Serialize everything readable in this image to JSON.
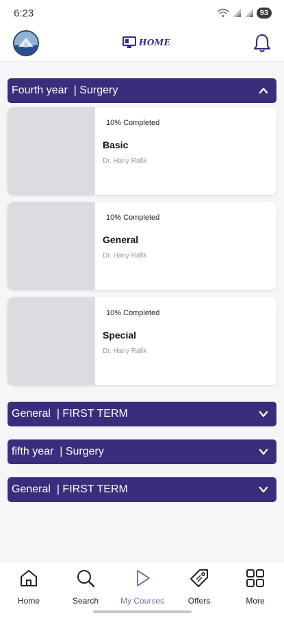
{
  "status_bar": {
    "time": "6:23",
    "battery": "93"
  },
  "header": {
    "logo_text": "HOME",
    "logo_icon": "monitor-logo-icon",
    "notification_icon": "bell-icon"
  },
  "accordions": [
    {
      "title": "Fourth year  | Surgery",
      "expanded": true,
      "courses": [
        {
          "progress": "10% Completed",
          "title": "Basic",
          "instructor": "Dr. Hany Rafik"
        },
        {
          "progress": "10% Completed",
          "title": "General",
          "instructor": "Dr. Hany Rafik"
        },
        {
          "progress": "10% Completed",
          "title": "Special",
          "instructor": "Dr. Hany Rafik"
        }
      ]
    },
    {
      "title": "General  | FIRST TERM",
      "expanded": false
    },
    {
      "title": "fifth year  | Surgery",
      "expanded": false
    },
    {
      "title": "General  | FIRST TERM",
      "expanded": false
    }
  ],
  "bottom_nav": [
    {
      "label": "Home",
      "icon": "home-icon"
    },
    {
      "label": "Search",
      "icon": "search-icon"
    },
    {
      "label": "My Courses",
      "icon": "play-icon",
      "active": true
    },
    {
      "label": "Offers",
      "icon": "tag-icon"
    },
    {
      "label": "More",
      "icon": "grid-icon"
    }
  ],
  "colors": {
    "accent": "#3c2c7c",
    "thumb_placeholder": "#dcdce0",
    "active_nav": "#7c73a8"
  }
}
